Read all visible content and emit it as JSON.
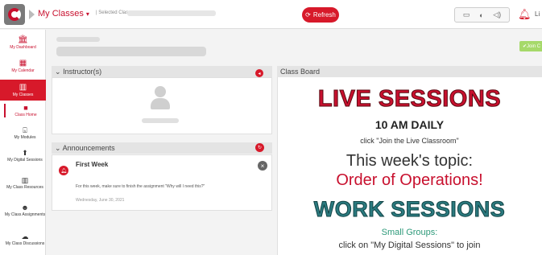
{
  "header": {
    "nav_title": "My Classes",
    "nav_chevron": "▾",
    "selected_class_label": "| Selected Class: ",
    "refresh_label": "Refresh",
    "user_initial": "Li"
  },
  "sidebar": {
    "items": [
      {
        "label": "My Dashboard",
        "icon": "🏛"
      },
      {
        "label": "My Calendar",
        "icon": "▦"
      },
      {
        "label": "My Classes",
        "icon": "▥"
      }
    ],
    "subitems": [
      {
        "label": "Class Home",
        "icon": "■"
      },
      {
        "label": "My Modules",
        "icon": "⌺"
      },
      {
        "label": "My Digital Sessions",
        "icon": "⬆"
      },
      {
        "label": "My Class Resources",
        "icon": "▥"
      },
      {
        "label": "My Class Assignments",
        "icon": "☻"
      },
      {
        "label": "My Class Discussions",
        "icon": "☁"
      }
    ]
  },
  "main": {
    "join_button_label": "✔Join C",
    "instructors_header": "Instructor(s)",
    "announcements_header": "Announcements",
    "announcement": {
      "title": "First Week",
      "text": "For this week, make sure to finish the assignment \"Why will I need this?\"",
      "date": "Wednesday, June 30, 2021"
    },
    "board_header": "Class Board",
    "board": {
      "live_sessions": "LIVE SESSIONS",
      "daily": "10 AM DAILY",
      "join_live": "click \"Join the Live Classroom\"",
      "topic": "This week's topic:",
      "order": "Order of Operations!",
      "work_sessions": "WORK SESSIONS",
      "small_groups": "Small Groups:",
      "click_digital": "click on \"My Digital Sessions\" to join"
    }
  },
  "colors": {
    "brand_red": "#c8102e",
    "button_red": "#d7192a",
    "work_teal": "#2b7a7f",
    "join_green": "#a6d96a"
  }
}
